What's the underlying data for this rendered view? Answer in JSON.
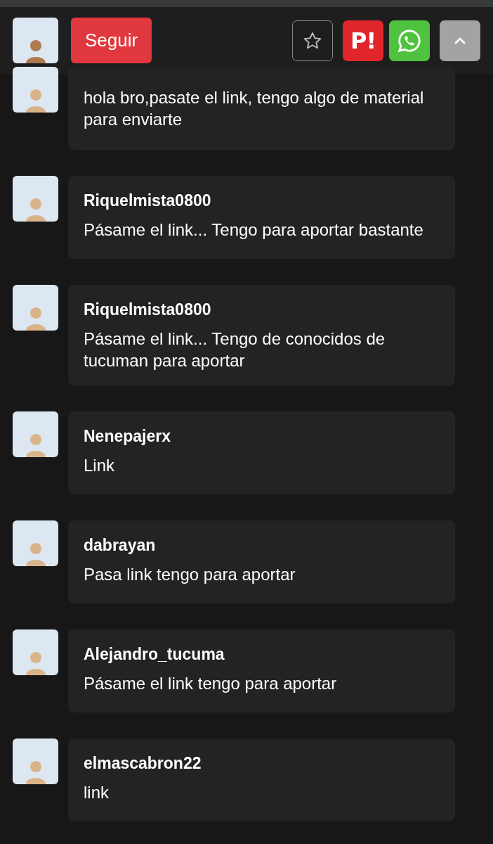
{
  "header": {
    "follow_button": "Seguir",
    "brand_badge": "P!"
  },
  "comments": [
    {
      "text": "hola bro,pasate el link, tengo algo de material para enviarte"
    },
    {
      "user": "Riquelmista0800",
      "text": "Pásame el link... Tengo para aportar bastante"
    },
    {
      "user": "Riquelmista0800",
      "text": "Pásame el link... Tengo de conocidos de tucuman para aportar"
    },
    {
      "user": "Nenepajerx",
      "text": "Link"
    },
    {
      "user": "dabrayan",
      "text": "Pasa link tengo para aportar"
    },
    {
      "user": "Alejandro_tucuma",
      "text": "Pásame el link tengo para aportar"
    },
    {
      "user": "elmascabron22",
      "text": "link"
    }
  ]
}
